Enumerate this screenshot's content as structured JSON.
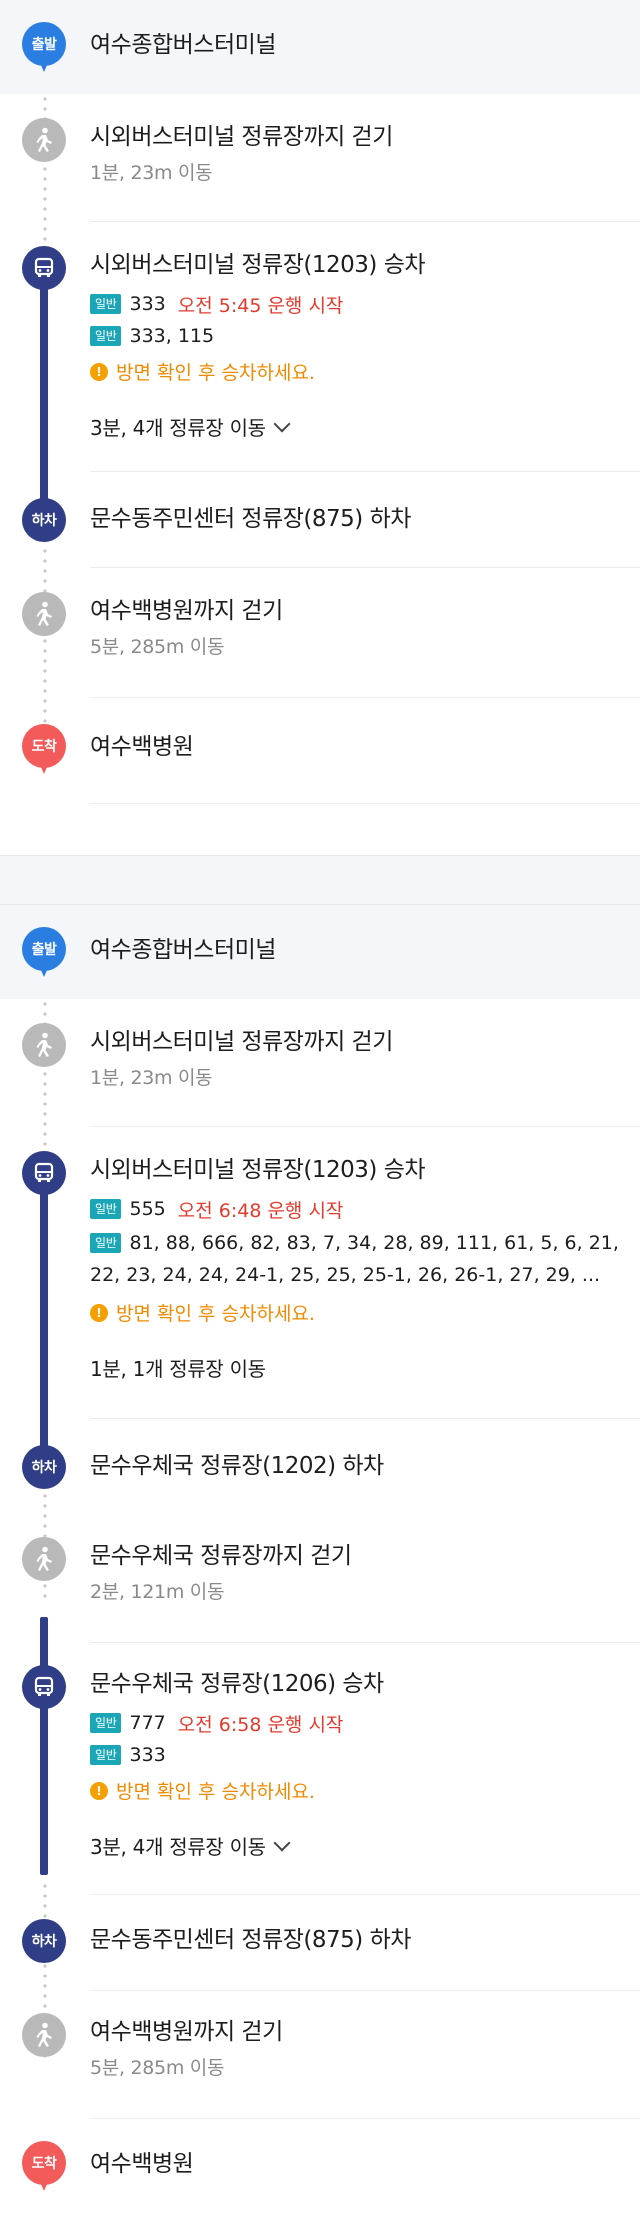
{
  "route1": {
    "start": {
      "badge": "출발",
      "name": "여수종합버스터미널"
    },
    "walk1": {
      "title": "시외버스터미널 정류장까지 걷기",
      "detail": "1분, 23m 이동"
    },
    "board": {
      "title": "시외버스터미널 정류장(1203) 승차",
      "buses": [
        {
          "type": "일반",
          "number": "333",
          "note": "오전 5:45 운행 시작"
        },
        {
          "type": "일반",
          "number": "333, 115",
          "note": ""
        }
      ],
      "warning": "방면 확인 후 승차하세요.",
      "stops": "3분, 4개 정류장 이동"
    },
    "alight": {
      "badge": "하차",
      "title": "문수동주민센터 정류장(875) 하차"
    },
    "walk2": {
      "title": "여수백병원까지 걷기",
      "detail": "5분, 285m 이동"
    },
    "end": {
      "badge": "도착",
      "name": "여수백병원"
    }
  },
  "route2": {
    "start": {
      "badge": "출발",
      "name": "여수종합버스터미널"
    },
    "walk1": {
      "title": "시외버스터미널 정류장까지 걷기",
      "detail": "1분, 23m 이동"
    },
    "board1": {
      "title": "시외버스터미널 정류장(1203) 승차",
      "buses": [
        {
          "type": "일반",
          "number": "555",
          "note": "오전 6:48 운행 시작"
        },
        {
          "type": "일반",
          "number": "81, 88, 666, 82, 83, 7, 34, 28, 89, 111, 61, 5, 6, 21,",
          "note": ""
        }
      ],
      "bus_continuation": "22, 23, 24, 24, 24-1, 25, 25, 25-1, 26, 26-1, 27, 29, ...",
      "warning": "방면 확인 후 승차하세요.",
      "stops": "1분, 1개 정류장 이동"
    },
    "alight1": {
      "badge": "하차",
      "title": "문수우체국 정류장(1202) 하차"
    },
    "walk2": {
      "title": "문수우체국 정류장까지 걷기",
      "detail": "2분, 121m 이동"
    },
    "board2": {
      "title": "문수우체국 정류장(1206) 승차",
      "buses": [
        {
          "type": "일반",
          "number": "777",
          "note": "오전 6:58 운행 시작"
        },
        {
          "type": "일반",
          "number": "333",
          "note": ""
        }
      ],
      "warning": "방면 확인 후 승차하세요.",
      "stops": "3분, 4개 정류장 이동"
    },
    "alight2": {
      "badge": "하차",
      "title": "문수동주민센터 정류장(875) 하차"
    },
    "walk3": {
      "title": "여수백병원까지 걷기",
      "detail": "5분, 285m 이동"
    },
    "end": {
      "badge": "도착",
      "name": "여수백병원"
    }
  },
  "colors": {
    "line": "#2f3e86",
    "start_pin": "#2a7de1",
    "end_pin": "#f35a5a",
    "badge": "#1aa6b7",
    "warning": "#f08a00",
    "start_time": "#e23b2e"
  }
}
